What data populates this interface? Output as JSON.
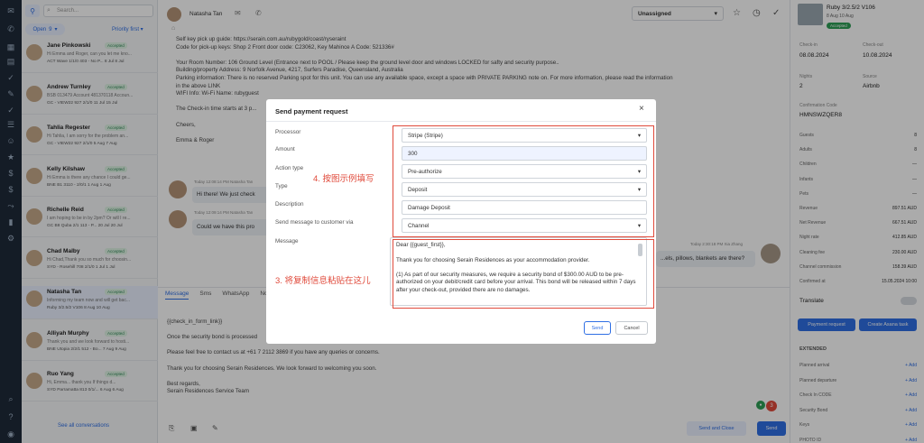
{
  "rail": {
    "icons": [
      "mail-icon",
      "chat-icon",
      "calendar-icon",
      "grid-icon",
      "check-icon",
      "brush-icon",
      "check-icon-2",
      "list-icon",
      "people-icon",
      "star-icon",
      "dollar-icon",
      "dollar-icon-2",
      "share-icon",
      "chart-icon",
      "gear-icon",
      "search-icon",
      "help-icon",
      "user-icon"
    ]
  },
  "list": {
    "search_placeholder": "Search...",
    "filter": "Open",
    "count": "9",
    "sort": "Priority first",
    "items": [
      {
        "name": "Jane Pinkowski",
        "badge": "Accepted",
        "preview": "Hi Emma and Roger, can you let me kno...",
        "meta": "ACT Wave 1/1/0 403 - No P... 8 Jul 8 Jul"
      },
      {
        "name": "Andrew Turnley",
        "badge": "Accepted",
        "preview": "BSB 013479 Account 481370118 Accoun...",
        "meta": "GC - VIEW22 927 2/1/0 11 Jul 15 Jul"
      },
      {
        "name": "Tahlia Regester",
        "badge": "Accepted",
        "preview": "Hi Tahlia, I am sorry for the problem an...",
        "meta": "GC - VIEW22 927 2/1/0 5 Aug 7 Aug"
      },
      {
        "name": "Kelly Kilshaw",
        "badge": "Accepted",
        "preview": "Hi Emma is there any chance I could ge...",
        "meta": "BNE B1 3110 - 2/0/1 1 Aug 1 Aug"
      },
      {
        "name": "Richelle Reid",
        "badge": "Accepted",
        "preview": "I am hoping to be in by 2pm? Or will I re...",
        "meta": "GC B8 Quba 2/1 113 - P... 20 Jul 20 Jul"
      },
      {
        "name": "Chad Malby",
        "badge": "Accepted",
        "preview": "Hi Chad,Thank you so much for choosin...",
        "meta": "SYD - Rosehill 708 2/1/0 1 Jul 1 Jul"
      },
      {
        "name": "Natasha Tan",
        "badge": "Accepted",
        "preview": "Informing my team now and will get bac...",
        "meta": "Ruby 3/2.5/2 V106 8 Aug 10 Aug"
      },
      {
        "name": "Alliyah Murphy",
        "badge": "Accepted",
        "preview": "Thank you and we look forward to hosti...",
        "meta": "BNE Utopia 2/2/1 512 - Bo... 7 Aug 9 Aug"
      },
      {
        "name": "Ruo Yang",
        "badge": "Accepted",
        "preview": "Hi, Emma... thank you If things d...",
        "meta": "SYD Parramatta 813 0/1/... 6 Aug 6 Aug"
      }
    ],
    "see_all": "See all conversations"
  },
  "center": {
    "contact": "Natasha Tan",
    "assign": "Unassigned",
    "msg_lines": [
      "Self key pick up guide: https://serain.com.au/rubygold/coast/ryseraint",
      "Code for pick-up keys: Shop 2 Front door code: C23062, Key Mahince A Code: 521336#",
      "",
      "Your Room Number: 106 Ground Level (Entrance next to POOL / Please keep the ground level door and windows LOCKED for safty and security purpose..",
      "Building/property Address: 9 Norfolk Avenue, 4217, Surfers Paradise, Queensland, Australia",
      "Parking information: There is no reserved Parking spot for this unit. You can use any available space, except a space with PRIVATE PARKING note on. For more information, please read the information",
      "in the above LINK",
      "WIFI Info: Wi-Fi Name: rubyguest",
      "",
      "The Check-in time starts at 3 p...",
      "",
      "Cheers,",
      "",
      "Emma & Roger"
    ],
    "bubble1_meta": "Today 12:08:14 PM  Natasha Tan",
    "bubble1": "Hi there! We just check",
    "bubble2_meta": "Today 12:09:14 PM  Natasha Tan",
    "bubble2": "Could we have this pro",
    "bubble3_meta": "Today 2:30:18 PM  Xia Zhang",
    "bubble3": "...els, pillows, blankets are there?",
    "tabs": [
      "Message",
      "Sms",
      "WhatsApp",
      "No"
    ],
    "compose_lines": [
      "{{check_in_form_link}}",
      "",
      "Once the security bond is processed",
      "",
      "Please feel free to contact us at +61 7 2112 3869 if you have any queries or concerns.",
      "",
      "Thank you for choosing Serain Residences. We look forward to welcoming you soon.",
      "",
      "Best regards,",
      "Serain Residences Service Team"
    ],
    "send_close": "Send and Close",
    "send": "Send",
    "badge_count": "3"
  },
  "right": {
    "title": "Ruby 3/2.5/2 V106",
    "dates": "8 Aug  10 Aug",
    "status": "Accepted",
    "checkin_label": "Check-in",
    "checkin": "08.08.2024",
    "checkout_label": "Check-out",
    "checkout": "10.08.2024",
    "nights_label": "Nights",
    "nights": "2",
    "source_label": "Source",
    "source": "Airbnb",
    "code_label": "Confirmation Code",
    "code": "HMNSWZQER8",
    "rows": [
      [
        "Guests",
        "8"
      ],
      [
        "Adults",
        "8"
      ],
      [
        "Children",
        "—"
      ],
      [
        "Infants",
        "—"
      ],
      [
        "Pets",
        "—"
      ],
      [
        "Revenue",
        "897.51 AUD"
      ],
      [
        "Net Revenue",
        "667.51 AUD"
      ],
      [
        "Night rate",
        "412.85 AUD"
      ],
      [
        "Cleaning fee",
        "230.00 AUD"
      ],
      [
        "Channel commission",
        "158.39 AUD"
      ],
      [
        "Confirmed at",
        "15.05.2024 10:00"
      ]
    ],
    "translate": "Translate",
    "pay_btn": "Payment request",
    "asana_btn": "Create Asana task",
    "extended": "EXTENDED",
    "ext": [
      "Planned arrival",
      "Planned departure",
      "Check In CODE",
      "Security Bond",
      "Keys",
      "PHOTO ID"
    ],
    "add": "+ Add"
  },
  "dialog": {
    "title": "Send payment request",
    "processor_label": "Processor",
    "processor": "Stripe (Stripe)",
    "amount_label": "Amount",
    "amount": "300",
    "action_label": "Action type",
    "action": "Pre-authorize",
    "type_label": "Type",
    "type": "Deposit",
    "desc_label": "Description",
    "desc": "Damage Deposit",
    "via_label": "Send message to customer via",
    "via": "Channel",
    "message_label": "Message",
    "message": "Dear {{guest_first}},\n\nThank you for choosing Serain Residences as your accommodation provider.\n\n(1) As part of our security measures, we require a security bond of $300.00 AUD to be pre-authorized on your debit/credit card before your arrival. This bond will be released within 7 days after your check-out, provided there are no damages.",
    "send": "Send",
    "cancel": "Cancel",
    "note4": "4. 按图示例填写",
    "note3": "3. 将复制信息粘贴在这儿"
  }
}
